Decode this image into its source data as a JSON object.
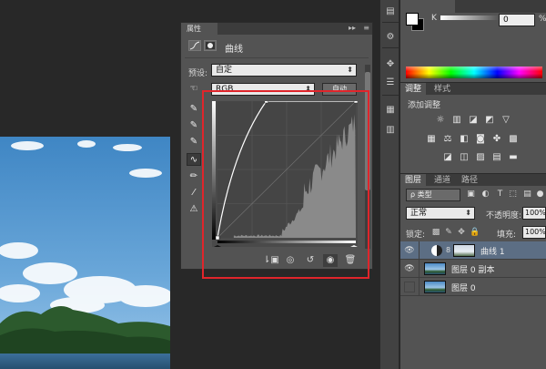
{
  "properties_panel": {
    "tab_label": "属性",
    "collapse_glyph": "▸▸",
    "menu_glyph": "≡",
    "title": "曲线",
    "preset_label": "预设:",
    "preset_value": "自定",
    "channel_value": "RGB",
    "auto_label": "自动"
  },
  "curves_chart": {
    "input_range": [
      0,
      255
    ],
    "output_range": [
      0,
      255
    ],
    "curve_points": [
      [
        0,
        0
      ],
      [
        90,
        255
      ],
      [
        255,
        255
      ]
    ],
    "histogram_shape": "concentrated in highlights",
    "grid": "4x4"
  },
  "color_panel": {
    "channel_label": "K",
    "value": "0",
    "unit": "%"
  },
  "adjustments_panel": {
    "tabs": [
      "调整",
      "样式"
    ],
    "add_label": "添加调整"
  },
  "layers_panel": {
    "tabs": [
      "图层",
      "通道",
      "路径"
    ],
    "filter_label": "ρ 类型",
    "blend_mode": "正常",
    "opacity_label": "不透明度:",
    "opacity_value": "100%",
    "lock_label": "锁定:",
    "fill_label": "填充:",
    "fill_value": "100%",
    "layers": [
      {
        "name": "曲线 1",
        "visible": true,
        "selected": true
      },
      {
        "name": "图层 0 副本",
        "visible": true,
        "selected": false
      },
      {
        "name": "图层 0",
        "visible": false,
        "selected": false
      }
    ]
  },
  "colors": {
    "highlight": "#e0252b",
    "selection": "#5c6e84",
    "panel": "#535353"
  }
}
